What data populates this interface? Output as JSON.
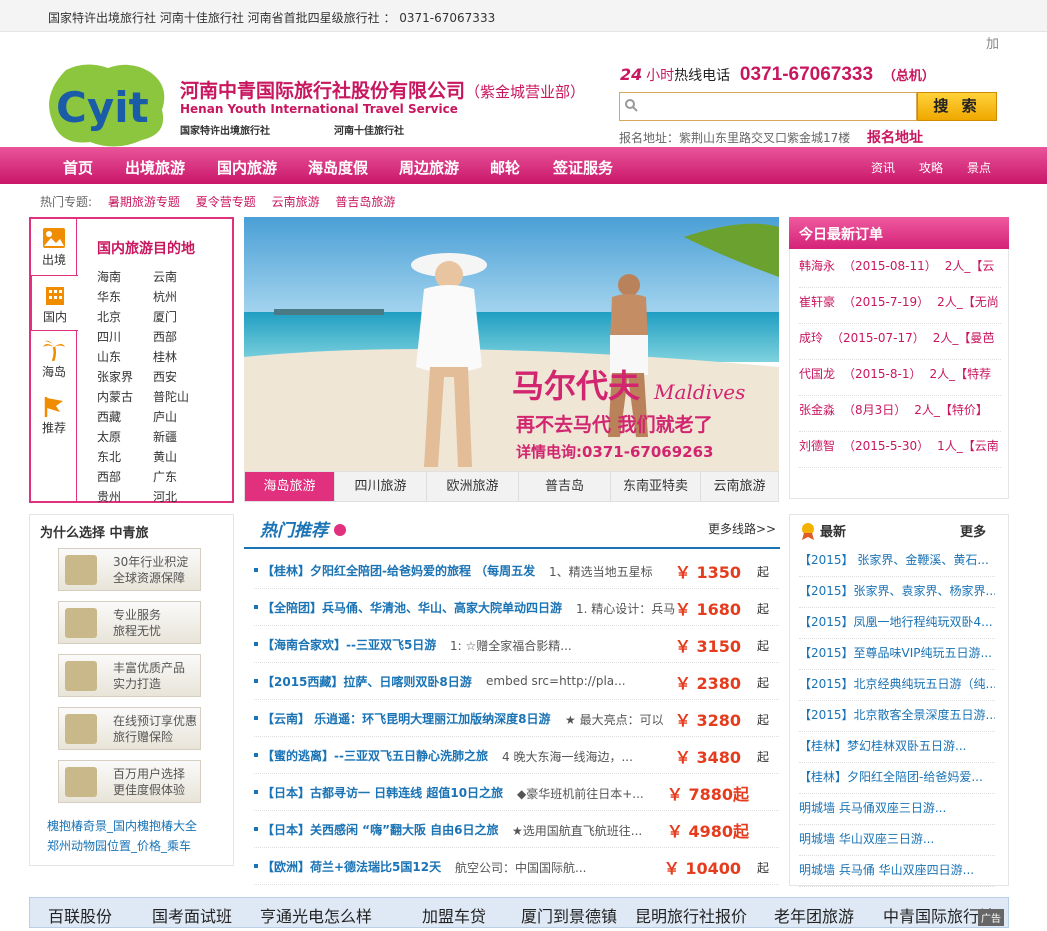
{
  "topbar": {
    "text": "国家特许出境旅行社  河南十佳旅行社  河南省首批四星级旅行社 ： 0371-67067333"
  },
  "header": {
    "jia": "加",
    "logo_text": "Cyit",
    "company_name": "河南中青国际旅行社股份有限公司",
    "company_branch": "（紫金城营业部）",
    "company_en": "Henan Youth International Travel Service",
    "tag1": "国家特许出境旅行社",
    "tag2": "河南十佳旅行社",
    "hotline_24": "24",
    "hotline_label1": "小时",
    "hotline_label2": "热线电话",
    "hotline_number": "0371-67067333",
    "hotline_boss": "（总机）",
    "search_button": "搜 索",
    "address": "报名地址：紫荆山东里路交叉口紫金城17楼",
    "address_link": "报名地址"
  },
  "nav": {
    "items": [
      "首页",
      "出境旅游",
      "国内旅游",
      "海岛度假",
      "周边旅游",
      "邮轮",
      "签证服务"
    ],
    "right": [
      "资讯",
      "攻略",
      "景点"
    ]
  },
  "hot_topics": {
    "label": "热门专题:",
    "items": [
      "暑期旅游专题",
      "夏令营专题",
      "云南旅游",
      "普吉岛旅游"
    ]
  },
  "destinations": {
    "tabs": [
      "出境",
      "国内",
      "海岛",
      "推荐"
    ],
    "title": "国内旅游目的地",
    "cities": [
      "海南",
      "云南",
      "华东",
      "杭州",
      "北京",
      "厦门",
      "四川",
      "西部",
      "山东",
      "桂林",
      "张家界",
      "西安",
      "内蒙古",
      "普陀山",
      "西藏",
      "庐山",
      "太原",
      "新疆",
      "东北",
      "黄山",
      "西部",
      "广东",
      "贵州",
      "河北"
    ]
  },
  "banner": {
    "title": "马尔代夫",
    "title_en": "Maldives",
    "slogan": "再不去马代 我们就老了",
    "phone": "详情电询:0371-67069263",
    "tabs": [
      "海岛旅游",
      "四川旅游",
      "欧洲旅游",
      "普吉岛",
      "东南亚特卖",
      "云南旅游"
    ]
  },
  "orders": {
    "title": "今日最新订单",
    "items": [
      {
        "name": "韩海永",
        "date": "（2015-08-11）",
        "info": "2人_【云"
      },
      {
        "name": "崔轩豪",
        "date": "（2015-7-19）",
        "info": "2人_【无尚"
      },
      {
        "name": "成玲",
        "date": "（2015-07-17）",
        "info": "2人_【曼芭"
      },
      {
        "name": "代国龙",
        "date": "（2015-8-1）",
        "info": "2人_【特荐"
      },
      {
        "name": "张金淼",
        "date": "（8月3日）",
        "info": "2人_【特价】"
      },
      {
        "name": "刘德智",
        "date": "（2015-5-30）",
        "info": "1人_【云南"
      }
    ]
  },
  "why": {
    "title": "为什么选择  中青旅",
    "items": [
      "30年行业积淀\n全球资源保障",
      "专业服务\n旅程无忧",
      "丰富优质产品\n实力打造",
      "在线预订享优惠\n旅行赠保险",
      "百万用户选择\n更佳度假体验"
    ],
    "links": [
      "槐抱椿奇景_国内槐抱椿大全",
      "郑州动物园位置_价格_乘车"
    ]
  },
  "recommend": {
    "title": "热门推荐",
    "more": "更多线路>>",
    "currency": "￥",
    "suffix": "起",
    "rows": [
      {
        "title": "【桂林】夕阳红全陪团-给爸妈爱的旅程 （每周五发",
        "desc": "1、精选当地五星标",
        "price": "1350"
      },
      {
        "title": "【全陪团】兵马俑、华清池、华山、高家大院单动四日游",
        "desc": "1. 精心设计：兵马",
        "price": "1680"
      },
      {
        "title": "【海南合家欢】--三亚双飞5日游",
        "desc": "1: ☆赠全家福合影精...",
        "price": "3150"
      },
      {
        "title": "【2015西藏】拉萨、日喀则双卧8日游",
        "desc": "embed src=http://pla...",
        "price": "2380"
      },
      {
        "title": "【云南】 乐逍遥：环飞昆明大理丽江加版纳深度8日游",
        "desc": "★ 最大亮点：可以",
        "price": "3280"
      },
      {
        "title": "【蜜的逃离】--三亚双飞五日静心洗肺之旅",
        "desc": "4 晚大东海一线海边，...",
        "price": "3480"
      },
      {
        "title": "【日本】古都寻访一 日韩连线 超值10日之旅",
        "desc": "◆豪华班机前往日本+...",
        "price": "7880起"
      },
      {
        "title": "【日本】关西感闲 “嗨”翻大阪 自由6日之旅",
        "desc": "★选用国航直飞航班往...",
        "price": "4980起"
      },
      {
        "title": "【欧洲】荷兰+德法瑞比5国12天",
        "desc": "航空公司：中国国际航...",
        "price": "10400"
      }
    ]
  },
  "latest": {
    "title": "最新",
    "more": "更多",
    "items": [
      "【2015】 张家界、金鞭溪、黄石...",
      "【2015】张家界、袁家界、杨家界...",
      "【2015】凤凰一地行程纯玩双卧4...",
      "【2015】至尊品味VIP纯玩五日游...",
      "【2015】北京经典纯玩五日游（纯...",
      "【2015】北京散客全景深度五日游...",
      "【桂林】梦幻桂林双卧五日游...",
      "【桂林】夕阳红全陪团-给爸妈爱...",
      "明城墙 兵马俑双座三日游...",
      "明城墙 华山双座三日游...",
      "明城墙 兵马俑 华山双座四日游..."
    ]
  },
  "ads": {
    "items": [
      "百联股份",
      "国考面试班",
      "亨通光电怎么样",
      "加盟车贷",
      "厦门到景德镇",
      "昆明旅行社报价",
      "老年团旅游",
      "中青国际旅行社"
    ],
    "tag": "广告"
  },
  "colors": {
    "brand_pink": "#c8165f",
    "link_blue": "#1a73b5",
    "price_red": "#e63c1e"
  }
}
